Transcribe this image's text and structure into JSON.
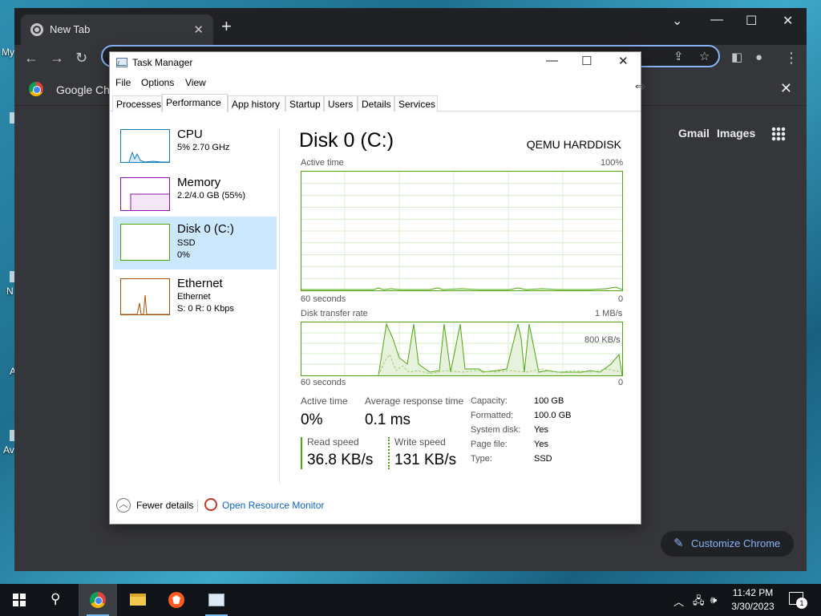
{
  "desktop": {
    "labels": [
      "My",
      "N",
      "A",
      "Av"
    ]
  },
  "chrome": {
    "tab_title": "New Tab",
    "new_tab_symbol": "+",
    "bookmark_label": "Google Chr",
    "ntp_links": [
      "Gmail",
      "Images"
    ],
    "customize_label": "Customize Chrome"
  },
  "task_manager": {
    "title": "Task Manager",
    "menu": [
      "File",
      "Options",
      "View"
    ],
    "tabs": [
      "Processes",
      "Performance",
      "App history",
      "Startup",
      "Users",
      "Details",
      "Services"
    ],
    "active_tab": "Performance",
    "sidebar": [
      {
        "name": "CPU",
        "sub1": "5%  2.70 GHz",
        "sub2": ""
      },
      {
        "name": "Memory",
        "sub1": "2.2/4.0 GB (55%)",
        "sub2": ""
      },
      {
        "name": "Disk 0 (C:)",
        "sub1": "SSD",
        "sub2": "0%"
      },
      {
        "name": "Ethernet",
        "sub1": "Ethernet",
        "sub2": "S: 0  R: 0 Kbps"
      }
    ],
    "detail": {
      "title": "Disk 0 (C:)",
      "model": "QEMU HARDDISK",
      "graph1_label": "Active time",
      "graph1_max": "100%",
      "graph1_time": "60 seconds",
      "graph1_min": "0",
      "graph2_label": "Disk transfer rate",
      "graph2_max": "1 MB/s",
      "graph2_mid": "800 KB/s",
      "graph2_time": "60 seconds",
      "graph2_min": "0",
      "stats": {
        "active_time_label": "Active time",
        "active_time_value": "0%",
        "avg_resp_label": "Average response time",
        "avg_resp_value": "0.1 ms",
        "read_label": "Read speed",
        "read_value": "36.8 KB/s",
        "write_label": "Write speed",
        "write_value": "131 KB/s"
      },
      "properties": [
        {
          "k": "Capacity:",
          "v": "100 GB"
        },
        {
          "k": "Formatted:",
          "v": "100.0 GB"
        },
        {
          "k": "System disk:",
          "v": "Yes"
        },
        {
          "k": "Page file:",
          "v": "Yes"
        },
        {
          "k": "Type:",
          "v": "SSD"
        }
      ]
    },
    "footer": {
      "fewer_details": "Fewer details",
      "open_resmon": "Open Resource Monitor"
    }
  },
  "taskbar": {
    "time": "11:42 PM",
    "date": "3/30/2023",
    "notification_count": "1"
  },
  "colors": {
    "disk_accent": "#4da60c",
    "cpu_accent": "#117dbb",
    "memory_accent": "#8b12ae",
    "ethernet_accent": "#a74f01",
    "selected_bg": "#cce8ff"
  }
}
